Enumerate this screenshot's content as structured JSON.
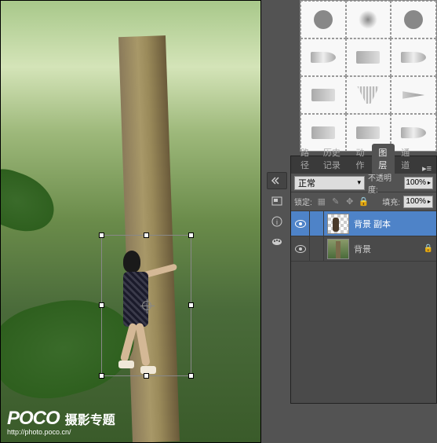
{
  "watermark": {
    "logo": "POCO",
    "cn": "摄影专题",
    "url": "http://photo.poco.cn/"
  },
  "panel": {
    "tabs": {
      "paths": "路径",
      "history": "历史记录",
      "actions": "动作",
      "layers": "图层",
      "channels": "通道"
    },
    "blend_mode": "正常",
    "opacity_label": "不透明度:",
    "opacity_value": "100%",
    "lock_label": "锁定:",
    "fill_label": "填充:",
    "fill_value": "100%"
  },
  "layers": [
    {
      "name": "背景 副本",
      "selected": true,
      "thumb": "masked"
    },
    {
      "name": "背景",
      "selected": false,
      "thumb": "bg",
      "locked": true
    }
  ]
}
